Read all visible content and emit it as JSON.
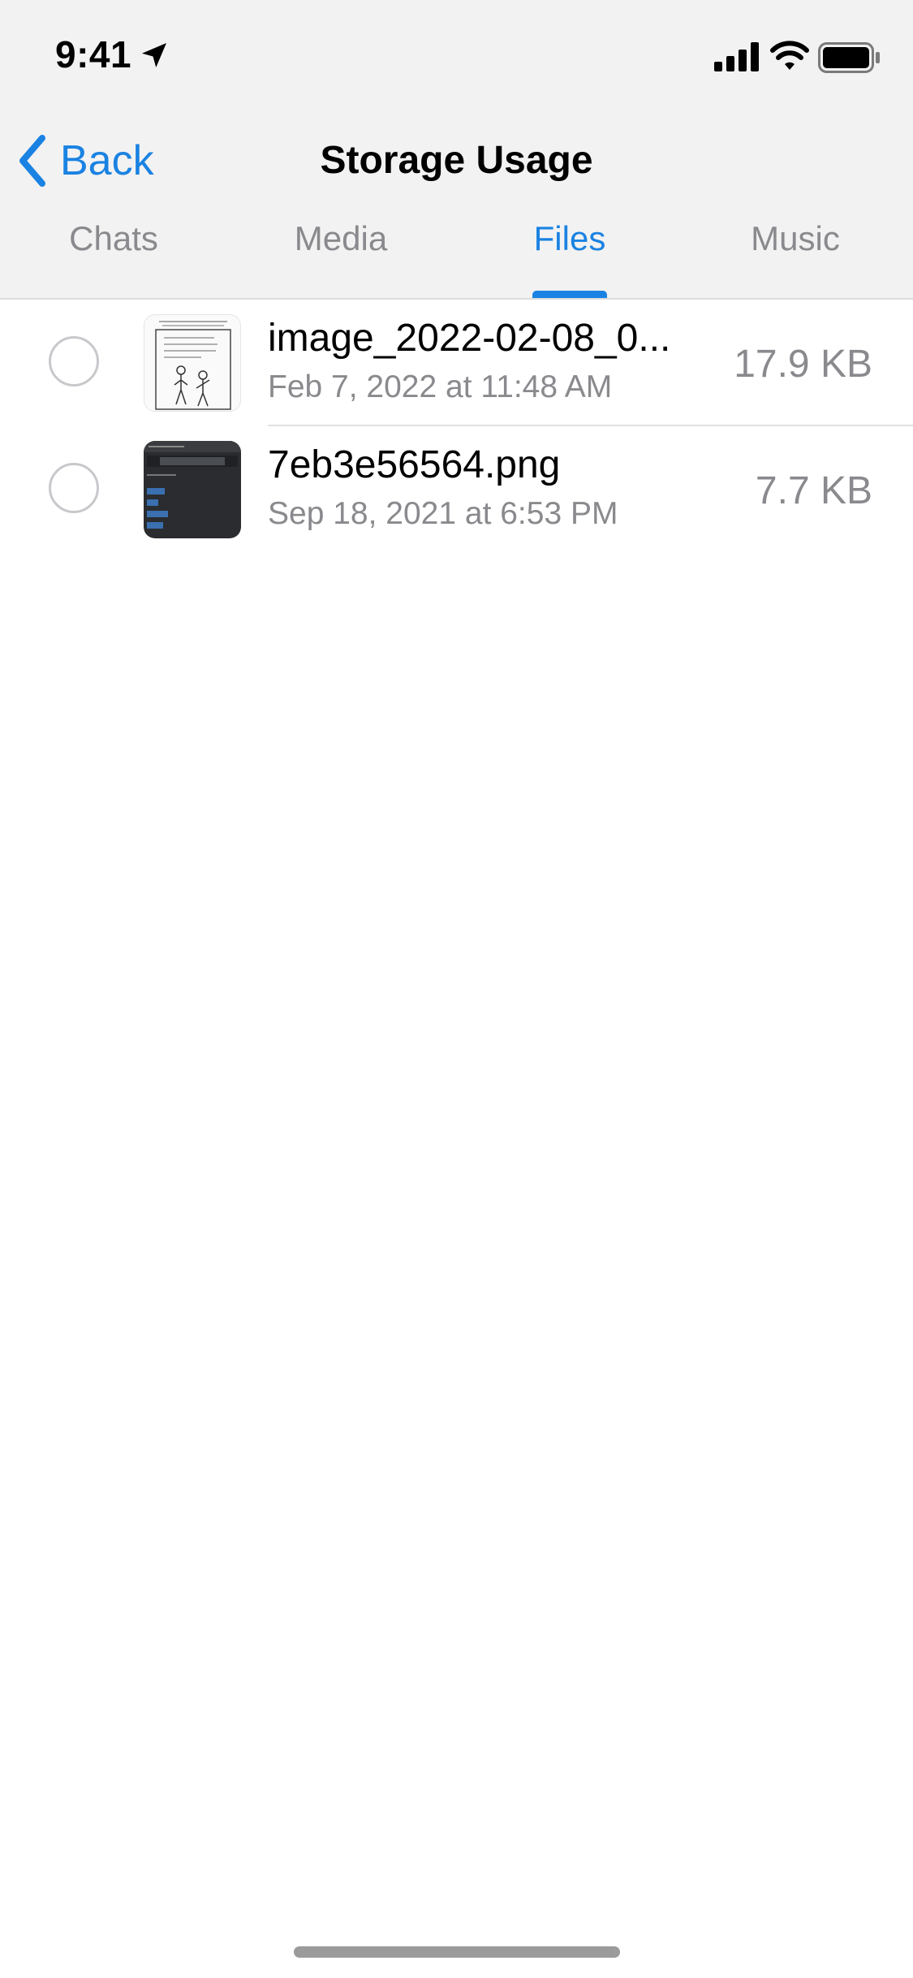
{
  "status_bar": {
    "time": "9:41"
  },
  "nav": {
    "back_label": "Back",
    "title": "Storage Usage"
  },
  "tabs": [
    {
      "label": "Chats",
      "active": false
    },
    {
      "label": "Media",
      "active": false
    },
    {
      "label": "Files",
      "active": true
    },
    {
      "label": "Music",
      "active": false
    }
  ],
  "files": [
    {
      "name": "image_2022-02-08_0...",
      "date": "Feb 7, 2022 at 11:48 AM",
      "size": "17.9 KB",
      "selected": false
    },
    {
      "name": "7eb3e56564.png",
      "date": "Sep 18, 2021 at 6:53 PM",
      "size": "7.7 KB",
      "selected": false
    }
  ],
  "colors": {
    "accent": "#1a82e2",
    "secondary_text": "#8a8a8e",
    "header_bg": "#f2f2f2"
  }
}
